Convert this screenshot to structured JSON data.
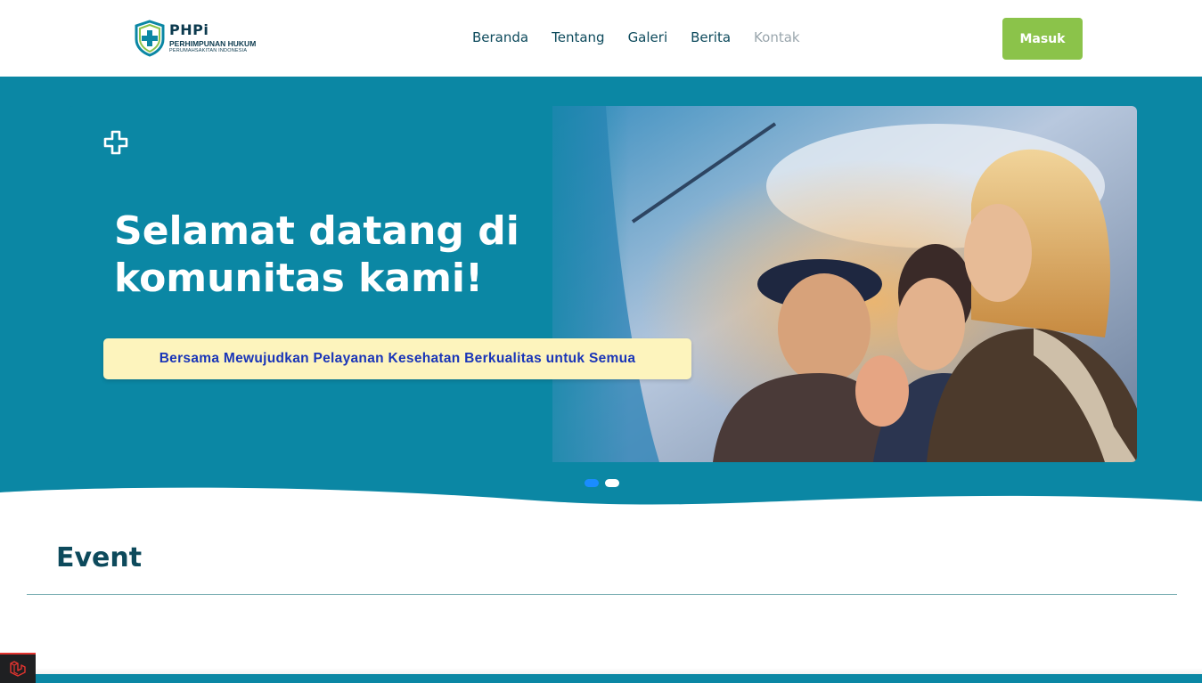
{
  "header": {
    "logo": {
      "abbr": "PHPi",
      "name": "PERHIMPUNAN HUKUM",
      "subtitle": "PERUMAHSAKITAN INDONESIA"
    },
    "nav": [
      {
        "label": "Beranda",
        "active": false
      },
      {
        "label": "Tentang",
        "active": false
      },
      {
        "label": "Galeri",
        "active": false
      },
      {
        "label": "Berita",
        "active": false
      },
      {
        "label": "Kontak",
        "active": true
      }
    ],
    "login_label": "Masuk"
  },
  "hero": {
    "icon": "medical-cross-icon",
    "title": "Selamat datang di komunitas kami!",
    "tagline": "Bersama Mewujudkan Pelayanan Kesehatan Berkualitas untuk Semua",
    "slides_count": 2,
    "active_slide": 1
  },
  "event": {
    "title": "Event"
  },
  "debug": {
    "icon": "laravel-icon"
  },
  "colors": {
    "primary": "#0b87a4",
    "dark_text": "#0d4a5c",
    "accent_green": "#8bc34a",
    "tagline_bg": "#fdf4bd",
    "tagline_text": "#1a35b8",
    "dot_active": "#1a8cff",
    "nav_muted": "#9aa6ad"
  }
}
